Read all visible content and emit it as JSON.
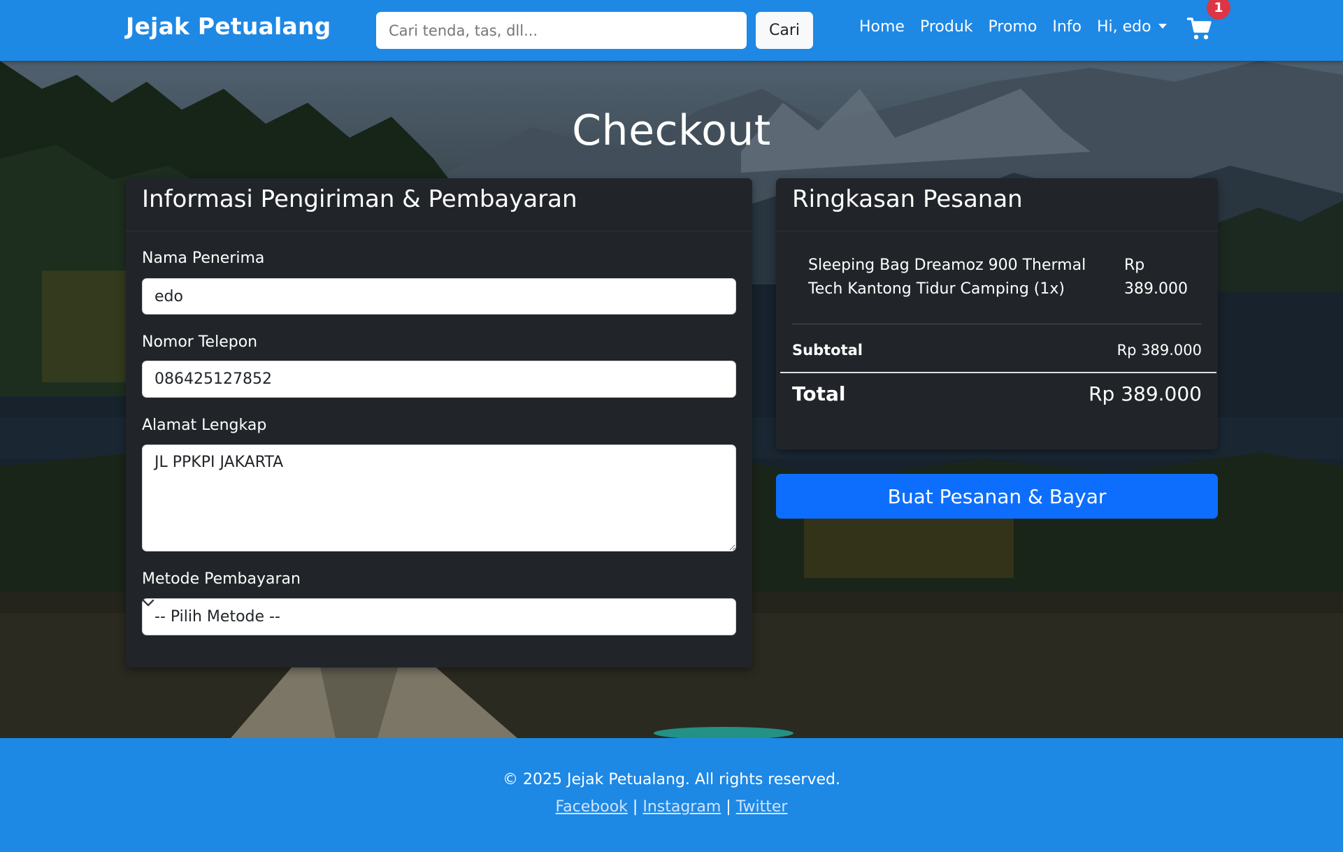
{
  "navbar": {
    "brand": "Jejak Petualang",
    "search_placeholder": "Cari tenda, tas, dll...",
    "search_button": "Cari",
    "links": [
      "Home",
      "Produk",
      "Promo",
      "Info"
    ],
    "user_menu": "Hi, edo",
    "cart_icon": "shopping-cart-icon",
    "cart_count": "1"
  },
  "page": {
    "title": "Checkout"
  },
  "shipping": {
    "header": "Informasi Pengiriman & Pembayaran",
    "name_label": "Nama Penerima",
    "name_value": "edo",
    "phone_label": "Nomor Telepon",
    "phone_value": "086425127852",
    "address_label": "Alamat Lengkap",
    "address_value": "JL PPKPI JAKARTA",
    "payment_label": "Metode Pembayaran",
    "payment_selected": "-- Pilih Metode --"
  },
  "summary": {
    "header": "Ringkasan Pesanan",
    "items": [
      {
        "name": "Sleeping Bag Dreamoz 900 Thermal Tech Kantong Tidur Camping (1x)",
        "price": "Rp 389.000"
      }
    ],
    "subtotal_label": "Subtotal",
    "subtotal_value": "Rp 389.000",
    "total_label": "Total",
    "total_value": "Rp 389.000"
  },
  "actions": {
    "pay_button": "Buat Pesanan & Bayar"
  },
  "footer": {
    "copyright": "© 2025 Jejak Petualang. All rights reserved.",
    "links": [
      "Facebook",
      "Instagram",
      "Twitter"
    ],
    "separator": "|"
  },
  "colors": {
    "primary": "#1e88e5",
    "card_bg": "#212529",
    "button_blue": "#0d6efd",
    "badge_red": "#dc3545"
  }
}
